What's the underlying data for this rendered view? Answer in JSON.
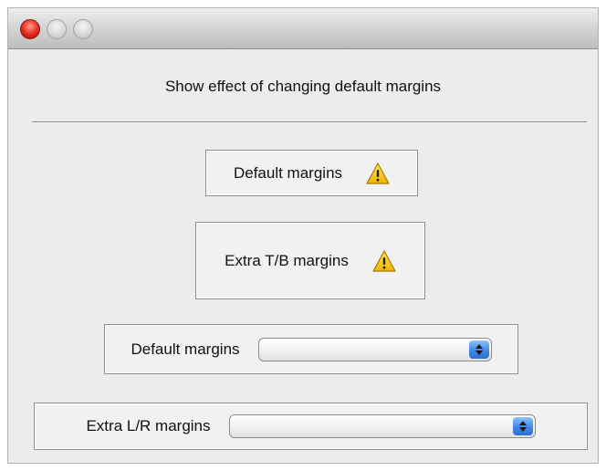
{
  "window": {
    "traffic_lights": [
      "close-button",
      "minimize-button",
      "zoom-button"
    ]
  },
  "heading": "Show effect of changing default margins",
  "panels": {
    "default_margins_label": "Default margins",
    "extra_tb_label": "Extra T/B margins",
    "default_margins_popup_label": "Default margins",
    "default_margins_popup_value": "",
    "extra_lr_label": "Extra L/R margins",
    "extra_lr_popup_value": ""
  },
  "icons": {
    "warning": "warning-icon"
  },
  "colors": {
    "close_button": "#e2281a",
    "warning_fill": "#f5c400",
    "popup_arrow_accent": "#3f87ea"
  }
}
